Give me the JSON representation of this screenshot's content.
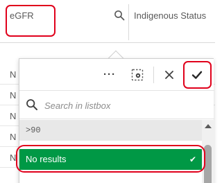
{
  "header": {
    "column1_title": "eGFR",
    "column2_title": "Indigenous Status"
  },
  "background_rows": [
    "N",
    "N",
    "N",
    "N",
    "N"
  ],
  "popover": {
    "toolbar": {
      "more_icon": "more-horizontal-icon",
      "selection_tool_icon": "lasso-select-icon",
      "cancel_icon": "close-icon",
      "confirm_icon": "checkmark-icon"
    },
    "search": {
      "placeholder": "Search in listbox"
    },
    "items": [
      {
        "label": ">90",
        "state": "alternative"
      },
      {
        "label": "No results",
        "state": "selected"
      }
    ]
  },
  "colors": {
    "selected_green": "#009845",
    "annotation_red": "#e0001b",
    "alternative_gray": "#e8e8e8"
  }
}
